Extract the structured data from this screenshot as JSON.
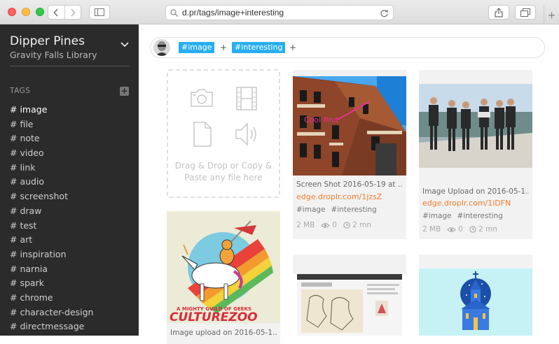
{
  "browser": {
    "url": "d.pr/tags/image+interesting",
    "new_tab_label": "+"
  },
  "sidebar": {
    "name": "Dipper Pines",
    "library": "Gravity Falls Library",
    "tags_heading": "TAGS",
    "add_label": "+",
    "tags": [
      "# image",
      "# file",
      "# note",
      "# video",
      "# link",
      "# audio",
      "# screenshot",
      "# draw",
      "# test",
      "# art",
      "# inspiration",
      "# narnia",
      "# spark",
      "# chrome",
      "# character-design",
      "# directmessage"
    ]
  },
  "filter": {
    "tags": [
      "#image",
      "#interesting"
    ],
    "plus": "+"
  },
  "dropzone": {
    "line1": "Drag & Drop or Copy &",
    "line2": "Paste any file here"
  },
  "cards": [
    {
      "title": "Screen Shot 2016-05-19 at ...",
      "link": "edge.droplr.com/1jzsZ",
      "tags": [
        "#image",
        "#interesting"
      ],
      "size": "2 MB",
      "views": "0",
      "time": "2 mn",
      "overlay_text": "Cool find"
    },
    {
      "title": "Image Upload on 2016-05-1...",
      "link": "edge.droplr.com/1iDFN",
      "tags": [
        "#image",
        "#interesting"
      ],
      "size": "2 MB",
      "views": "0",
      "time": "2 mn"
    },
    {
      "title": "Image upload on 2016-05-1...",
      "art_text_top": "A MIGHTY GUILD OF GEEKS",
      "art_text_main": "CULTUREZOO"
    }
  ],
  "colors": {
    "accent": "#29aef0",
    "link": "#f07d2c",
    "sidebar_bg": "#2b2b2b"
  }
}
